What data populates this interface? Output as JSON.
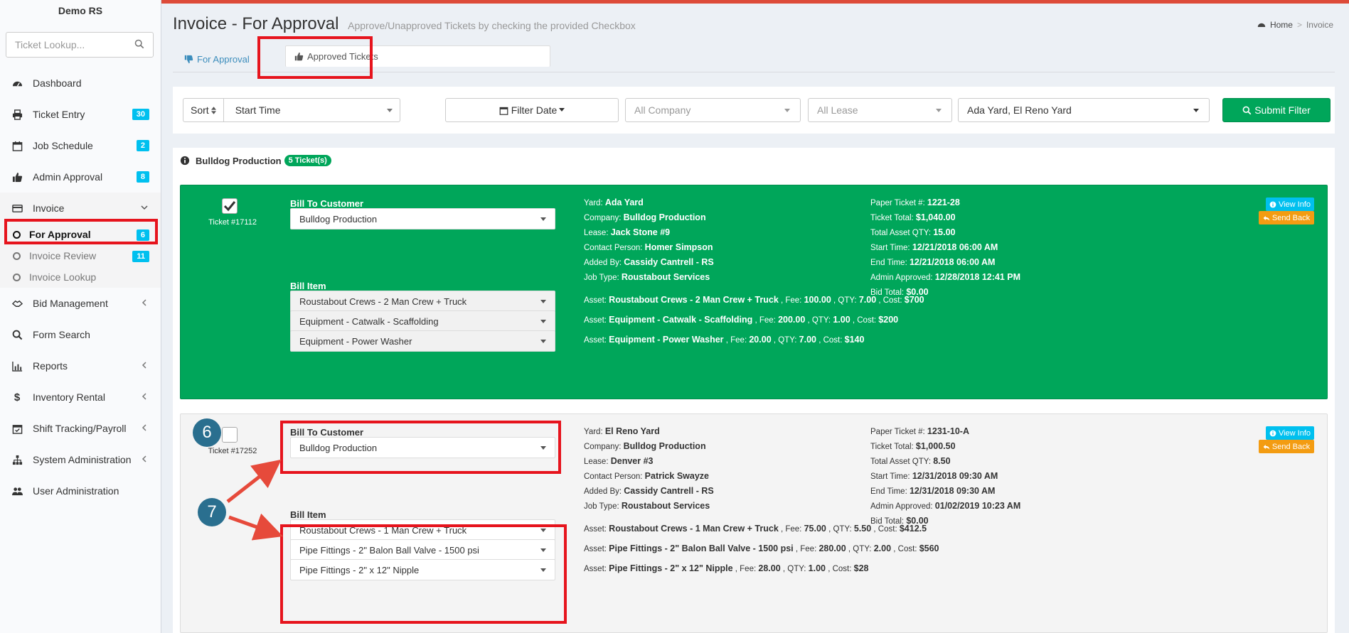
{
  "sidebar": {
    "brand": "Demo RS",
    "lookup_placeholder": "Ticket Lookup...",
    "items": [
      {
        "label": "Dashboard"
      },
      {
        "label": "Ticket Entry",
        "badge": "30"
      },
      {
        "label": "Job Schedule",
        "badge": "2"
      },
      {
        "label": "Admin Approval",
        "badge": "8"
      },
      {
        "label": "Invoice"
      },
      {
        "label": "Bid Management"
      },
      {
        "label": "Form Search"
      },
      {
        "label": "Reports"
      },
      {
        "label": "Inventory Rental"
      },
      {
        "label": "Shift Tracking/Payroll"
      },
      {
        "label": "System Administration"
      },
      {
        "label": "User Administration"
      }
    ],
    "invoice_sub": [
      {
        "label": "For Approval",
        "badge": "6"
      },
      {
        "label": "Invoice Review",
        "badge": "11"
      },
      {
        "label": "Invoice Lookup"
      }
    ]
  },
  "header": {
    "title": "Invoice - For Approval",
    "subtitle": "Approve/Unapproved Tickets by checking the provided Checkbox",
    "breadcrumb_home": "Home",
    "breadcrumb_current": "Invoice"
  },
  "tabs": {
    "for_approval": "For Approval",
    "approved": "Approved Tickets"
  },
  "filters": {
    "sort_label": "Sort",
    "sort_value": "Start Time",
    "filter_date": "Filter Date",
    "company_placeholder": "All Company",
    "lease_placeholder": "All Lease",
    "yard_value": "Ada Yard, El Reno Yard",
    "submit": "Submit Filter"
  },
  "group": {
    "name": "Bulldog Production",
    "count": "5 Ticket(s)"
  },
  "labels": {
    "bill_to": "Bill To Customer",
    "bill_item": "Bill Item",
    "view_info": "View Info",
    "send_back": "Send Back"
  },
  "tickets": [
    {
      "number": "Ticket #17112",
      "checked": true,
      "customer": "Bulldog Production",
      "items": [
        "Roustabout Crews - 2 Man Crew + Truck",
        "Equipment - Catwalk - Scaffolding",
        "Equipment - Power Washer"
      ],
      "left": [
        {
          "k": "Yard:",
          "v": "Ada Yard"
        },
        {
          "k": "Company:",
          "v": "Bulldog Production"
        },
        {
          "k": "Lease:",
          "v": "Jack Stone #9"
        },
        {
          "k": "Contact Person:",
          "v": "Homer Simpson"
        },
        {
          "k": "Added By:",
          "v": "Cassidy Cantrell - RS"
        },
        {
          "k": "Job Type:",
          "v": "Roustabout Services"
        }
      ],
      "right": [
        {
          "k": "Paper Ticket #:",
          "v": "1221-28"
        },
        {
          "k": "Ticket Total:",
          "v": "$1,040.00"
        },
        {
          "k": "Total Asset QTY:",
          "v": "15.00"
        },
        {
          "k": "Start Time:",
          "v": "12/21/2018 06:00 AM"
        },
        {
          "k": "End Time:",
          "v": "12/21/2018 06:00 AM"
        },
        {
          "k": "Admin Approved:",
          "v": "12/28/2018 12:41 PM"
        },
        {
          "k": "Bid Total:",
          "v": "$0.00"
        }
      ],
      "assets": [
        {
          "name": "Roustabout Crews - 2 Man Crew + Truck",
          "fee": "100.00",
          "qty": "7.00",
          "cost": "$700"
        },
        {
          "name": "Equipment - Catwalk - Scaffolding",
          "fee": "200.00",
          "qty": "1.00",
          "cost": "$200"
        },
        {
          "name": "Equipment - Power Washer",
          "fee": "20.00",
          "qty": "7.00",
          "cost": "$140"
        }
      ]
    },
    {
      "number": "Ticket #17252",
      "checked": false,
      "customer": "Bulldog Production",
      "items": [
        "Roustabout Crews - 1 Man Crew + Truck",
        "Pipe Fittings - 2\" Balon Ball Valve - 1500 psi",
        "Pipe Fittings - 2\" x 12\" Nipple"
      ],
      "left": [
        {
          "k": "Yard:",
          "v": "El Reno Yard"
        },
        {
          "k": "Company:",
          "v": "Bulldog Production"
        },
        {
          "k": "Lease:",
          "v": "Denver #3"
        },
        {
          "k": "Contact Person:",
          "v": "Patrick Swayze"
        },
        {
          "k": "Added By:",
          "v": "Cassidy Cantrell - RS"
        },
        {
          "k": "Job Type:",
          "v": "Roustabout Services"
        }
      ],
      "right": [
        {
          "k": "Paper Ticket #:",
          "v": "1231-10-A"
        },
        {
          "k": "Ticket Total:",
          "v": "$1,000.50"
        },
        {
          "k": "Total Asset QTY:",
          "v": "8.50"
        },
        {
          "k": "Start Time:",
          "v": "12/31/2018 09:30 AM"
        },
        {
          "k": "End Time:",
          "v": "12/31/2018 09:30 AM"
        },
        {
          "k": "Admin Approved:",
          "v": "01/02/2019 10:23 AM"
        },
        {
          "k": "Bid Total:",
          "v": "$0.00"
        }
      ],
      "assets": [
        {
          "name": "Roustabout Crews - 1 Man Crew + Truck",
          "fee": "75.00",
          "qty": "5.50",
          "cost": "$412.5"
        },
        {
          "name": "Pipe Fittings - 2\" Balon Ball Valve - 1500 psi",
          "fee": "280.00",
          "qty": "2.00",
          "cost": "$560"
        },
        {
          "name": "Pipe Fittings - 2\" x 12\" Nipple",
          "fee": "28.00",
          "qty": "1.00",
          "cost": "$28"
        }
      ]
    }
  ],
  "asset_labels": {
    "asset": "Asset:",
    "fee": ", Fee:",
    "qty": ", QTY:",
    "cost": ", Cost:"
  },
  "annotations": {
    "step6": "6",
    "step7": "7"
  },
  "colors": {
    "accent": "#3c8dbc",
    "green": "#00a65a",
    "orange": "#f39c12",
    "info": "#00c0ef",
    "highlight": "#e6141d",
    "step": "#2a6f8f"
  }
}
